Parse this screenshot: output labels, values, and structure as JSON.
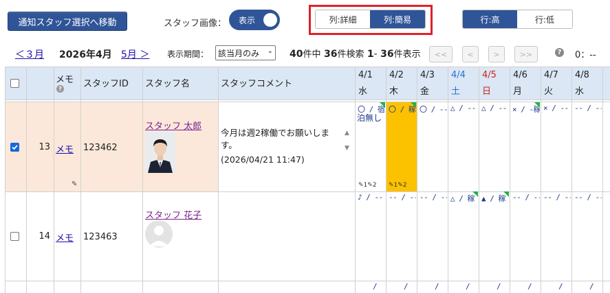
{
  "toolbar": {
    "notify_button": "通知スタッフ選択へ移動",
    "staff_image_label": "スタッフ画像：",
    "staff_image_toggle": "表示",
    "col_detail": "列:詳細",
    "col_simple": "列:簡易",
    "row_high": "行:高",
    "row_low": "行:低"
  },
  "nav": {
    "prev_month": "＜３月",
    "current_month": "2026年4月",
    "next_month": "5月 ＞",
    "period_label": "表示期間：",
    "period_value": "該当月のみ",
    "count_total": "40",
    "count_total_suffix": "件中",
    "count_search": "36",
    "count_search_suffix": "件検索",
    "range_start": "1",
    "range_sep": "-",
    "range_end": "36",
    "range_suffix": "件表示",
    "first": "<<",
    "prev": "<",
    "next": ">",
    "last": ">>",
    "clock": "0：--"
  },
  "table": {
    "headers": {
      "memo": "メモ",
      "staff_id": "スタッフID",
      "staff_name": "スタッフ名",
      "staff_comment": "スタッフコメント"
    },
    "days": [
      {
        "date": "4/1",
        "dow": "水",
        "color": "#222222"
      },
      {
        "date": "4/2",
        "dow": "木",
        "color": "#222222"
      },
      {
        "date": "4/3",
        "dow": "金",
        "color": "#222222"
      },
      {
        "date": "4/4",
        "dow": "土",
        "color": "#2a6fd0"
      },
      {
        "date": "4/5",
        "dow": "日",
        "color": "#d01f1f"
      },
      {
        "date": "4/6",
        "dow": "月",
        "color": "#222222"
      },
      {
        "date": "4/7",
        "dow": "火",
        "color": "#222222"
      },
      {
        "date": "4/8",
        "dow": "水",
        "color": "#222222"
      }
    ],
    "rows": [
      {
        "num": "13",
        "memo": "メモ",
        "staff_id": "123462",
        "name": "スタッフ 太郎",
        "comment": "今月は週2稼働でお願いします。",
        "comment_date": "(2026/04/21 11:47)",
        "cells": [
          "〇 / 宿",
          "〇 / 稼",
          "〇 / --",
          "△ / --",
          "△ / --",
          "× / -稼",
          "× / --",
          "-- / --"
        ],
        "cell1_extra": "泊無し",
        "counts_a": "1",
        "counts_b": "2"
      },
      {
        "num": "14",
        "memo": "メモ",
        "staff_id": "123463",
        "name": "スタッフ 花子",
        "cells": [
          "♪ / --",
          "-- / --",
          "-- / --",
          "△ / 稼",
          "▲ / 稼",
          "-- / --",
          "-- / --",
          "-- / --"
        ]
      }
    ]
  },
  "colors": {
    "navy": "#2f5497",
    "selected_row": "#fbe8da",
    "header_bg": "#dbe7f4",
    "highlight_cell": "#fcc200",
    "red_frame": "#e0202a"
  }
}
